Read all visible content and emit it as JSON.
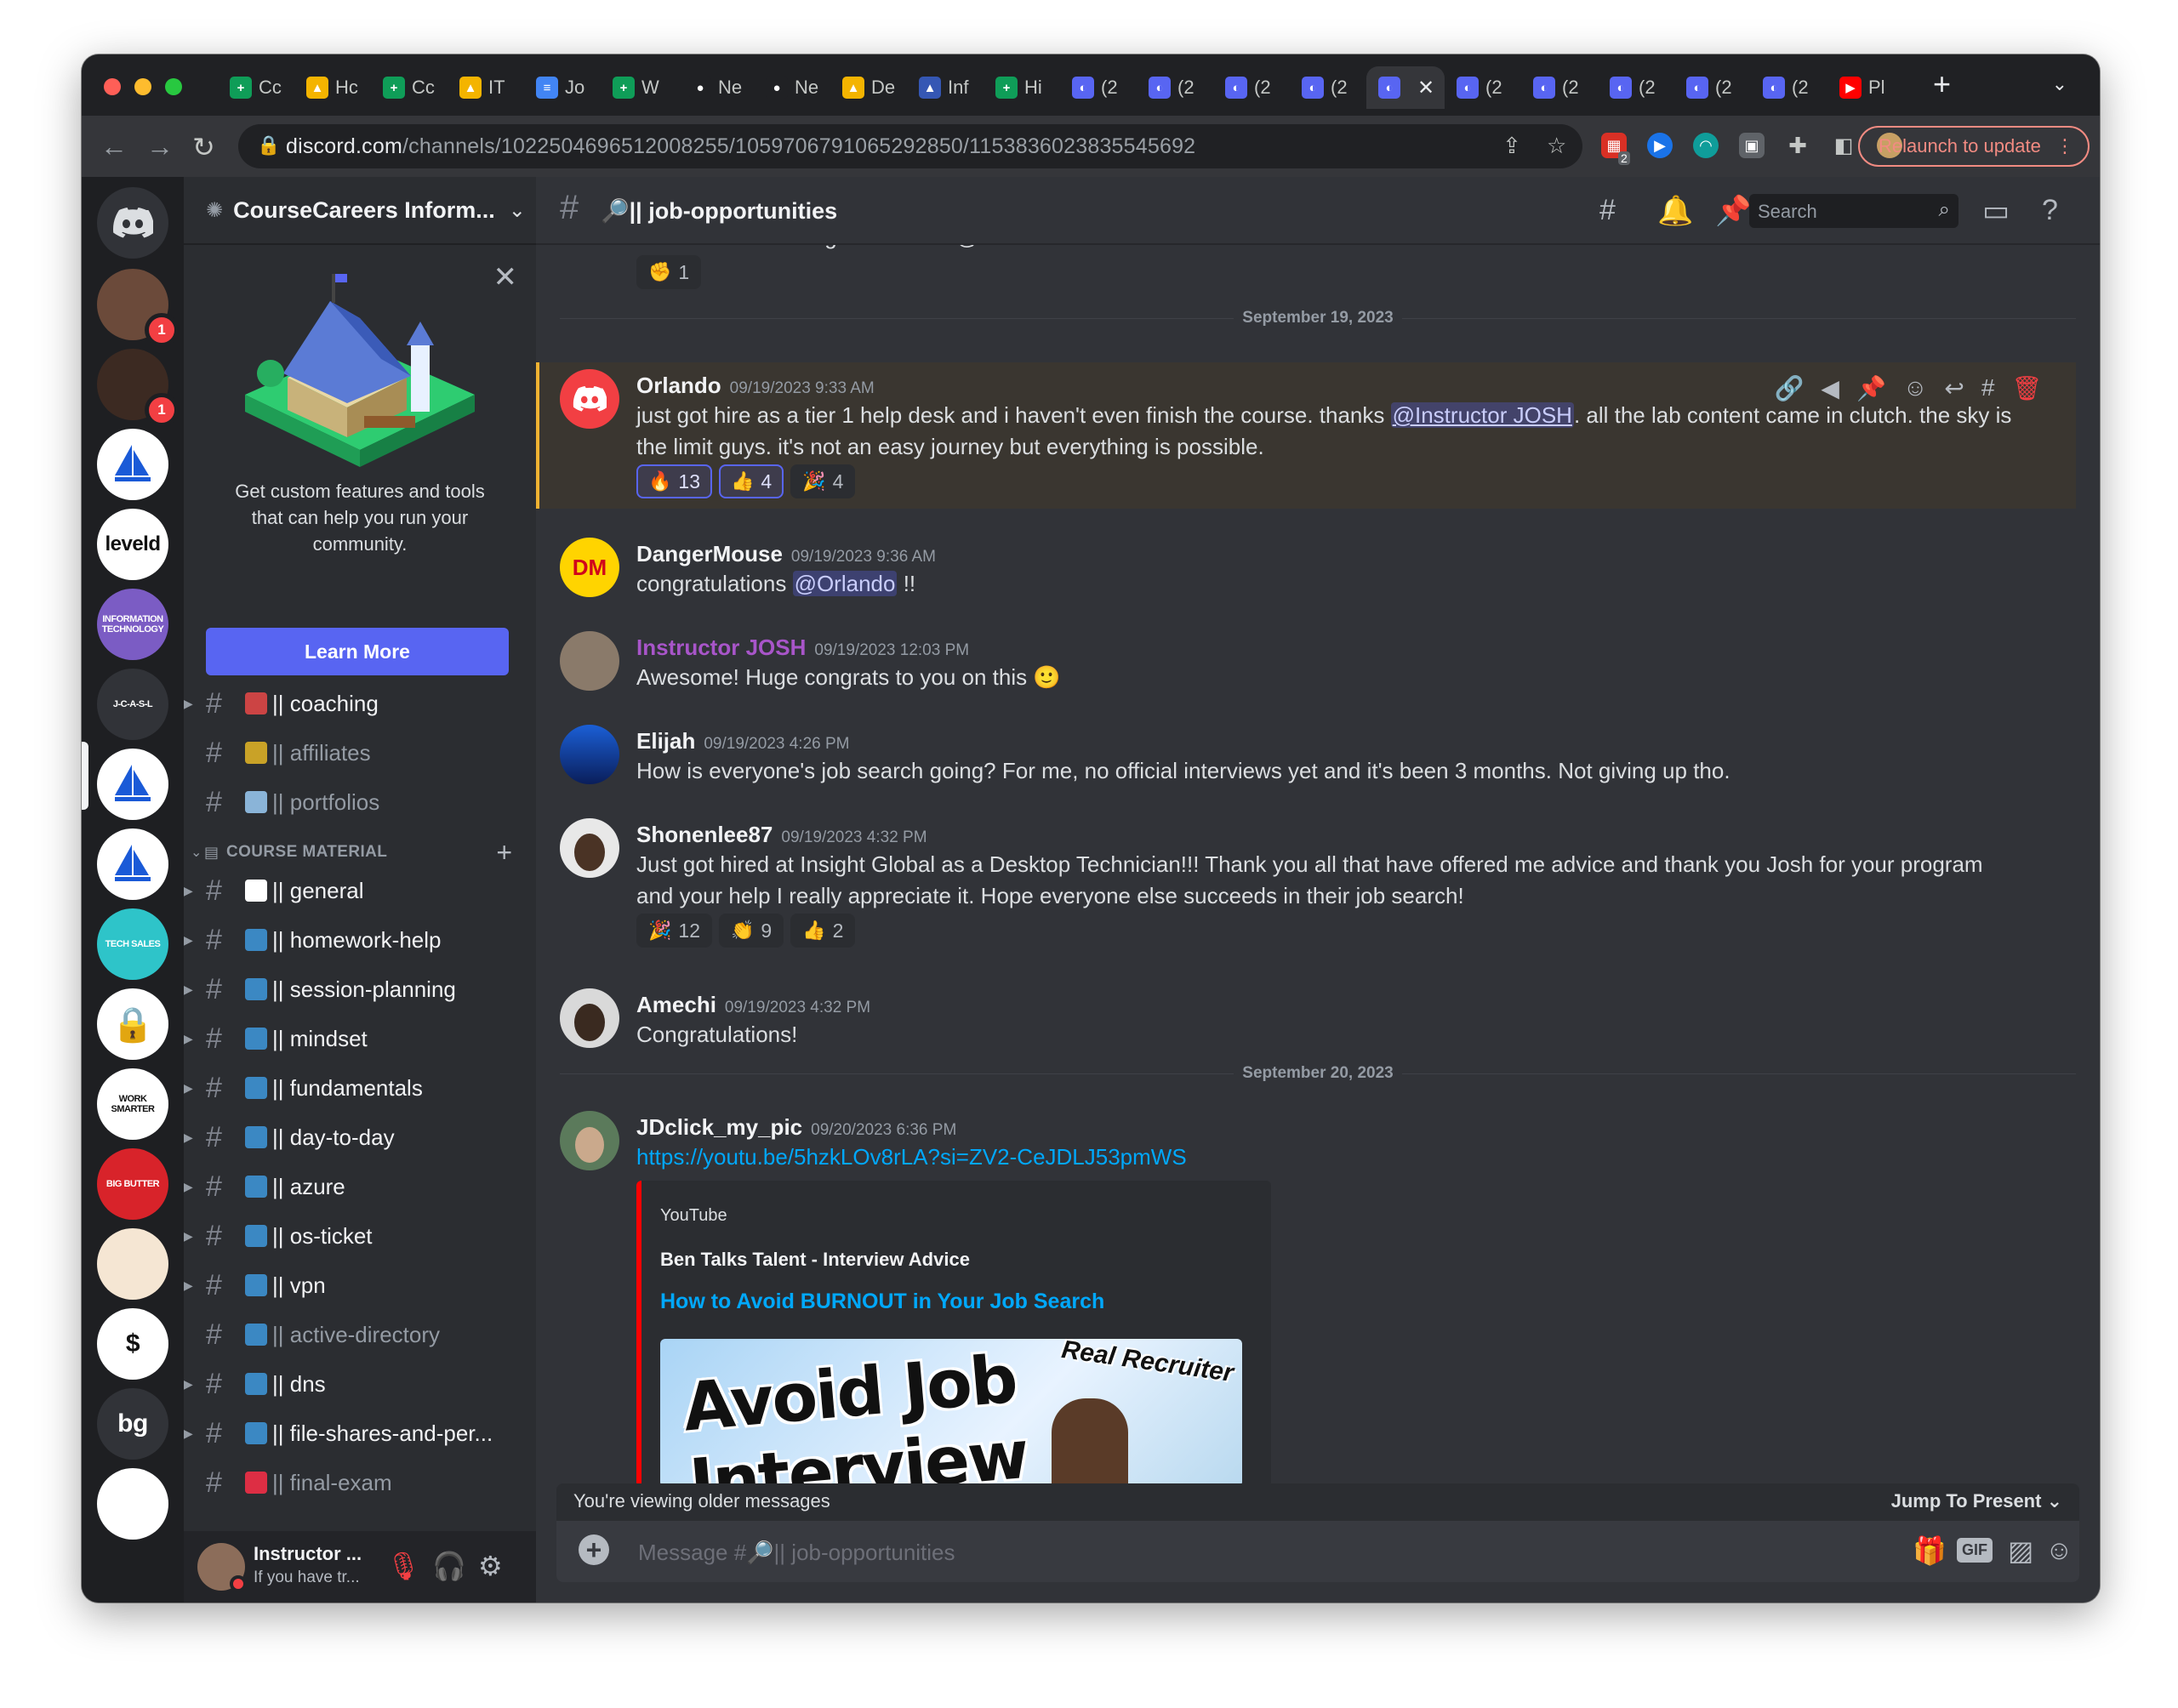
{
  "browser": {
    "tabs": [
      {
        "label": "Cc",
        "icon": "google-sheets-icon",
        "color": "#0f9d58",
        "glyph": "+"
      },
      {
        "label": "Hc",
        "icon": "google-drive-icon",
        "color": "#f4b400",
        "glyph": "▲"
      },
      {
        "label": "Cc",
        "icon": "google-sheets-icon",
        "color": "#0f9d58",
        "glyph": "+"
      },
      {
        "label": "IT",
        "icon": "google-drive-icon",
        "color": "#f4b400",
        "glyph": "▲"
      },
      {
        "label": "Jo",
        "icon": "google-docs-icon",
        "color": "#4285f4",
        "glyph": "≡"
      },
      {
        "label": "W",
        "icon": "google-sheets-icon",
        "color": "#0f9d58",
        "glyph": "+"
      },
      {
        "label": "Ne",
        "icon": "github-icon",
        "color": "#202124",
        "glyph": "●"
      },
      {
        "label": "Ne",
        "icon": "github-icon",
        "color": "#202124",
        "glyph": "●"
      },
      {
        "label": "De",
        "icon": "google-drive-icon",
        "color": "#f4b400",
        "glyph": "▲"
      },
      {
        "label": "Inf",
        "icon": "app-icon",
        "color": "#3557b4",
        "glyph": "▲"
      },
      {
        "label": "Hi",
        "icon": "google-sheets-icon",
        "color": "#0f9d58",
        "glyph": "+"
      },
      {
        "label": "(2",
        "icon": "discord-icon",
        "color": "#5865f2",
        "glyph": "◐"
      },
      {
        "label": "(2",
        "icon": "discord-icon",
        "color": "#5865f2",
        "glyph": "◐"
      },
      {
        "label": "(2",
        "icon": "discord-icon",
        "color": "#5865f2",
        "glyph": "◐"
      },
      {
        "label": "(2",
        "icon": "discord-icon",
        "color": "#5865f2",
        "glyph": "◐"
      },
      {
        "label": "",
        "icon": "discord-icon",
        "color": "#5865f2",
        "glyph": "◐",
        "active": true
      },
      {
        "label": "(2",
        "icon": "discord-icon",
        "color": "#5865f2",
        "glyph": "◐"
      },
      {
        "label": "(2",
        "icon": "discord-icon",
        "color": "#5865f2",
        "glyph": "◐"
      },
      {
        "label": "(2",
        "icon": "discord-icon",
        "color": "#5865f2",
        "glyph": "◐"
      },
      {
        "label": "(2",
        "icon": "discord-icon",
        "color": "#5865f2",
        "glyph": "◐"
      },
      {
        "label": "(2",
        "icon": "discord-icon",
        "color": "#5865f2",
        "glyph": "◐"
      },
      {
        "label": "Pl",
        "icon": "youtube-icon",
        "color": "#ff0000",
        "glyph": "▶"
      }
    ],
    "url_host": "discord.com",
    "url_path": "/channels/1022504696512008255/1059706791065292850/1153836023835545692",
    "relaunch_label": "Relaunch to update",
    "ext_badge": "2"
  },
  "servers": [
    {
      "name": "avatar-1",
      "color": "#6b4a3a",
      "badge": "1"
    },
    {
      "name": "avatar-2",
      "color": "#3c2a22",
      "badge": "1"
    },
    {
      "name": "sailboat",
      "color": "#ffffff"
    },
    {
      "name": "leveld",
      "color": "#ffffff",
      "text": "leveld"
    },
    {
      "name": "info-tech",
      "color": "#7b5cc4",
      "text": "INFORMATION TECHNOLOGY"
    },
    {
      "name": "jcasl",
      "color": "#313338",
      "text": "J-C-A-S-L"
    },
    {
      "name": "sail-1",
      "color": "#ffffff"
    },
    {
      "name": "sail-2",
      "color": "#ffffff"
    },
    {
      "name": "tech-sales",
      "color": "#2ec4c9",
      "text": "TECH SALES"
    },
    {
      "name": "lock",
      "color": "#ffffff"
    },
    {
      "name": "work-smarter",
      "color": "#ffffff",
      "text": "WORK SMARTER"
    },
    {
      "name": "big-butter",
      "color": "#d8232a",
      "text": "BIG BUTTER"
    },
    {
      "name": "anime",
      "color": "#f5e6d3"
    },
    {
      "name": "money",
      "color": "#ffffff",
      "text": "$"
    },
    {
      "name": "bg",
      "color": "#313338",
      "text": "bg"
    },
    {
      "name": "sketch",
      "color": "#ffffff"
    }
  ],
  "guild": {
    "name": "CourseCareers Inform...",
    "promo_text": "Get custom features and tools that can help you run your community.",
    "learn_more": "Learn More"
  },
  "channels_top": [
    {
      "name": "|| coaching",
      "emoji_color": "#c44",
      "muted": false
    },
    {
      "name": "|| affiliates",
      "emoji_color": "#c9a227",
      "muted": true
    },
    {
      "name": "|| portfolios",
      "emoji_color": "#8ab4d8",
      "muted": true
    }
  ],
  "category": "COURSE MATERIAL",
  "channels": [
    {
      "name": "|| general",
      "emoji_color": "#ffffff",
      "muted": false
    },
    {
      "name": "|| homework-help",
      "emoji_color": "#3b88c3",
      "muted": false
    },
    {
      "name": "|| session-planning",
      "emoji_color": "#3b88c3",
      "muted": false
    },
    {
      "name": "|| mindset",
      "emoji_color": "#3b88c3",
      "muted": false
    },
    {
      "name": "|| fundamentals",
      "emoji_color": "#3b88c3",
      "muted": false
    },
    {
      "name": "|| day-to-day",
      "emoji_color": "#3b88c3",
      "muted": false
    },
    {
      "name": "|| azure",
      "emoji_color": "#3b88c3",
      "muted": false
    },
    {
      "name": "|| os-ticket",
      "emoji_color": "#3b88c3",
      "muted": false
    },
    {
      "name": "|| vpn",
      "emoji_color": "#3b88c3",
      "muted": false
    },
    {
      "name": "|| active-directory",
      "emoji_color": "#3b88c3",
      "muted": true
    },
    {
      "name": "|| dns",
      "emoji_color": "#3b88c3",
      "muted": false
    },
    {
      "name": "|| file-shares-and-per...",
      "emoji_color": "#3b88c3",
      "muted": false
    },
    {
      "name": "|| final-exam",
      "emoji_color": "#dd2e44",
      "muted": true
    }
  ],
  "user_panel": {
    "name": "Instructor ...",
    "status": "If you have tr..."
  },
  "channel": {
    "name": "|| job-opportunities",
    "search_placeholder": "Search"
  },
  "messages": {
    "partial_text": "Awesome... You're gonna nail it! @Jane",
    "partial_reaction": "1",
    "day1": "September 19, 2023",
    "day2": "September 20, 2023",
    "m1": {
      "author": "Orlando",
      "ts": "09/19/2023 9:33 AM",
      "text_a": "just got hire as a tier 1 help desk and i haven't even finish the course. thanks ",
      "mention": "@Instructor JOSH",
      "text_b": ". all the lab content came in clutch. the sky is the limit guys. it's not an easy journey but everything is possible.",
      "reactions": [
        {
          "emoji": "🔥",
          "count": "13"
        },
        {
          "emoji": "👍",
          "count": "4"
        },
        {
          "emoji": "🎉",
          "count": "4"
        }
      ]
    },
    "m2": {
      "author": "DangerMouse",
      "ts": "09/19/2023 9:36 AM",
      "text_a": "congratulations ",
      "mention": "@Orlando",
      "text_b": " !!",
      "avatar_text": "DM"
    },
    "m3": {
      "author": "Instructor JOSH",
      "ts": "09/19/2023 12:03 PM",
      "text": "Awesome! Huge congrats to you on this 🙂",
      "author_color": "#a855c9"
    },
    "m4": {
      "author": "Elijah",
      "ts": "09/19/2023 4:26 PM",
      "text": "How is everyone's job search going? For me, no official interviews yet and it's been 3 months. Not giving up tho."
    },
    "m5": {
      "author": "Shonenlee87",
      "ts": "09/19/2023 4:32 PM",
      "text": "Just got hired at Insight Global as a Desktop Technician!!! Thank you all that have offered me advice and thank you Josh for your program and your help I really appreciate it. Hope everyone else succeeds in their job search!",
      "reactions": [
        {
          "emoji": "🎉",
          "count": "12"
        },
        {
          "emoji": "👏",
          "count": "9"
        },
        {
          "emoji": "👍",
          "count": "2"
        }
      ]
    },
    "m6": {
      "author": "Amechi",
      "ts": "09/19/2023 4:32 PM",
      "text": "Congratulations!"
    },
    "m7": {
      "author": "JDclick_my_pic",
      "ts": "09/20/2023 6:36 PM",
      "link": "https://youtu.be/5hzkLOv8rLA?si=ZV2-CeJDLJ53pmWS",
      "embed_provider": "YouTube",
      "embed_author": "Ben Talks Talent - Interview Advice",
      "embed_title": "How to Avoid BURNOUT in Your Job Search",
      "thumb_title": "Avoid Job Interview",
      "thumb_tag": "Real Recruiter"
    }
  },
  "older_bar": {
    "text": "You're viewing older messages",
    "jump": "Jump To Present"
  },
  "composer": {
    "placeholder": "Message #🔎|| job-opportunities",
    "gif": "GIF"
  },
  "colors": {
    "accent": "#5865f2",
    "highlight_bar": "#f0b232",
    "mention_bg": "#3c4270"
  }
}
